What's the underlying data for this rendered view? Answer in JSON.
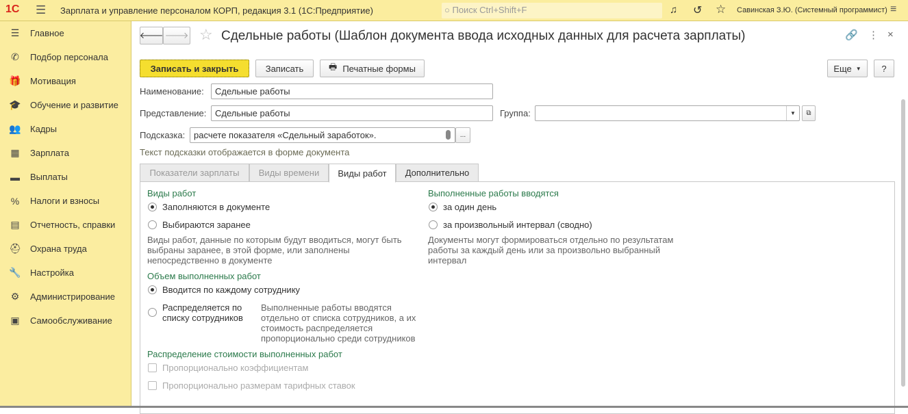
{
  "app": {
    "title": "Зарплата и управление персоналом КОРП, редакция 3.1  (1С:Предприятие)",
    "logo": "1С",
    "search_placeholder": "Поиск Ctrl+Shift+F",
    "user": "Савинская З.Ю. (Системный программист)"
  },
  "sidebar": {
    "items": [
      {
        "label": "Главное",
        "icon": "☰"
      },
      {
        "label": "Подбор персонала",
        "icon": "✆"
      },
      {
        "label": "Мотивация",
        "icon": "🎁"
      },
      {
        "label": "Обучение и развитие",
        "icon": "🎓"
      },
      {
        "label": "Кадры",
        "icon": "👥"
      },
      {
        "label": "Зарплата",
        "icon": "▦"
      },
      {
        "label": "Выплаты",
        "icon": "▬"
      },
      {
        "label": "Налоги и взносы",
        "icon": "%"
      },
      {
        "label": "Отчетность, справки",
        "icon": "▤"
      },
      {
        "label": "Охрана труда",
        "icon": "⛑"
      },
      {
        "label": "Настройка",
        "icon": "🔧"
      },
      {
        "label": "Администрирование",
        "icon": "⚙"
      },
      {
        "label": "Самообслуживание",
        "icon": "▣"
      }
    ]
  },
  "form": {
    "title": "Сдельные работы (Шаблон документа ввода исходных данных для расчета зарплаты)",
    "toolbar": {
      "save_close": "Записать и закрыть",
      "save": "Записать",
      "print": "Печатные формы",
      "more": "Еще",
      "help": "?"
    },
    "name_label": "Наименование:",
    "name_value": "Сдельные работы",
    "repr_label": "Представление:",
    "repr_value": "Сдельные работы",
    "group_label": "Группа:",
    "group_value": "",
    "hint_label": "Подсказка:",
    "hint_value": "расчете показателя «Сдельный заработок».",
    "hint_note": "Текст подсказки отображается в форме документа",
    "tabs": [
      "Показатели зарплаты",
      "Виды времени",
      "Виды работ",
      "Дополнительно"
    ],
    "work_types": {
      "title": "Виды работ",
      "opt1": "Заполняются в документе",
      "opt2": "Выбираются заранее",
      "note": "Виды работ, данные по которым будут вводиться, могут быть выбраны заранее, в этой форме, или заполнены непосредственно в документе"
    },
    "volume": {
      "title": "Объем выполненных работ",
      "opt1": "Вводится по каждому сотруднику",
      "opt2": "Распределяется по списку сотрудников",
      "note": "Выполненные работы вводятся отдельно от списка сотрудников, а их стоимость распределяется пропорционально среди сотрудников"
    },
    "entered": {
      "title": "Выполненные работы вводятся",
      "opt1": "за один день",
      "opt2": "за произвольный интервал (сводно)",
      "note": "Документы могут формироваться отдельно по результатам работы за каждый день или за произвольно выбранный интервал"
    },
    "distribution": {
      "title": "Распределение стоимости выполненных работ",
      "opt1": "Пропорционально коэффициентам",
      "opt2": "Пропорционально размерам тарифных ставок"
    }
  }
}
